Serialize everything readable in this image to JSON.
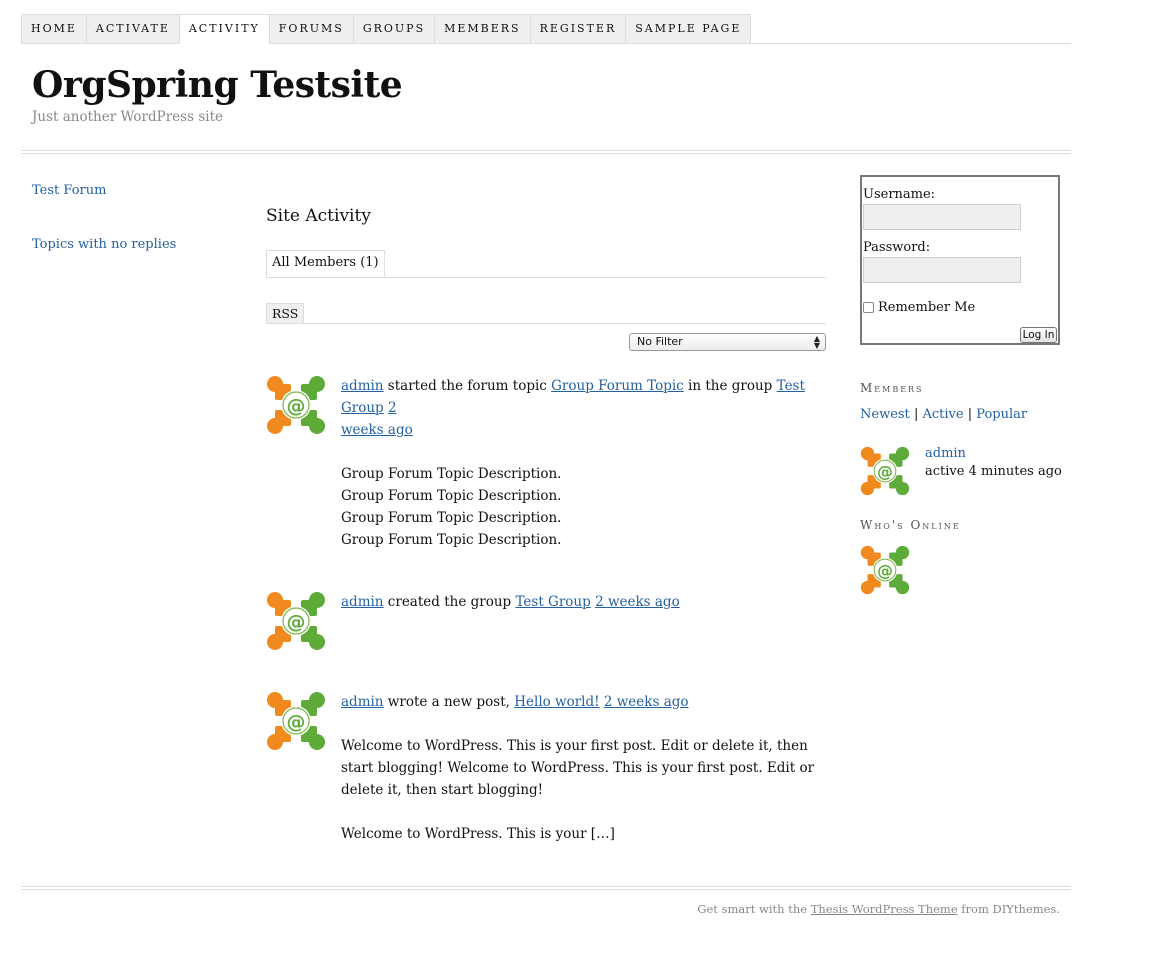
{
  "nav": {
    "items": [
      {
        "label": "HOME",
        "active": false
      },
      {
        "label": "ACTIVATE",
        "active": false
      },
      {
        "label": "ACTIVITY",
        "active": true
      },
      {
        "label": "FORUMS",
        "active": false
      },
      {
        "label": "GROUPS",
        "active": false
      },
      {
        "label": "MEMBERS",
        "active": false
      },
      {
        "label": "REGISTER",
        "active": false
      },
      {
        "label": "SAMPLE PAGE",
        "active": false
      }
    ]
  },
  "header": {
    "title": "OrgSpring Testsite",
    "tagline": "Just another WordPress site"
  },
  "left_sidebar": {
    "items": [
      "Test Forum",
      "Topics with no replies"
    ]
  },
  "main": {
    "heading": "Site Activity",
    "member_tab": "All Members (1)",
    "rss_label": "RSS",
    "filter_selected": "No Filter",
    "activities": [
      {
        "user": "admin",
        "action_1": " started the forum topic ",
        "topic": "Group Forum Topic",
        "action_2": " in the group ",
        "group": "Test Group",
        "time_1": "2",
        "time_2": "weeks ago",
        "content_lines": [
          "Group Forum Topic Description.",
          "Group Forum Topic Description.",
          "Group Forum Topic Description.",
          "Group Forum Topic Description."
        ]
      },
      {
        "user": "admin",
        "action": " created the group ",
        "group": "Test Group",
        "time": "2 weeks ago"
      },
      {
        "user": "admin",
        "action": " wrote a new post, ",
        "post": "Hello world!",
        "time": "2 weeks ago",
        "content_para_1": "Welcome to WordPress. This is your first post. Edit or delete it, then start blogging! Welcome to WordPress. This is your first post. Edit or delete it, then start blogging!",
        "content_para_2": "Welcome to WordPress. This is your […]"
      }
    ]
  },
  "login": {
    "username_label": "Username:",
    "password_label": "Password:",
    "remember_label": "Remember Me",
    "button_label": "Log In"
  },
  "members_widget": {
    "title": "Members",
    "tabs": [
      "Newest",
      "Active",
      "Popular"
    ],
    "separator": "|",
    "member_name": "admin",
    "member_status": "active 4 minutes ago"
  },
  "whos_online": {
    "title": "Who's Online"
  },
  "footer": {
    "prefix": "Get smart with the ",
    "link": "Thesis WordPress Theme",
    "suffix": " from DIYthemes."
  },
  "colors": {
    "link": "#2361a1",
    "avatar_orange": "#f08a1e",
    "avatar_green": "#5eab3a"
  },
  "icons": {
    "avatar": "at-sign-avatar-icon",
    "select_arrows": "updown-arrows-icon"
  }
}
